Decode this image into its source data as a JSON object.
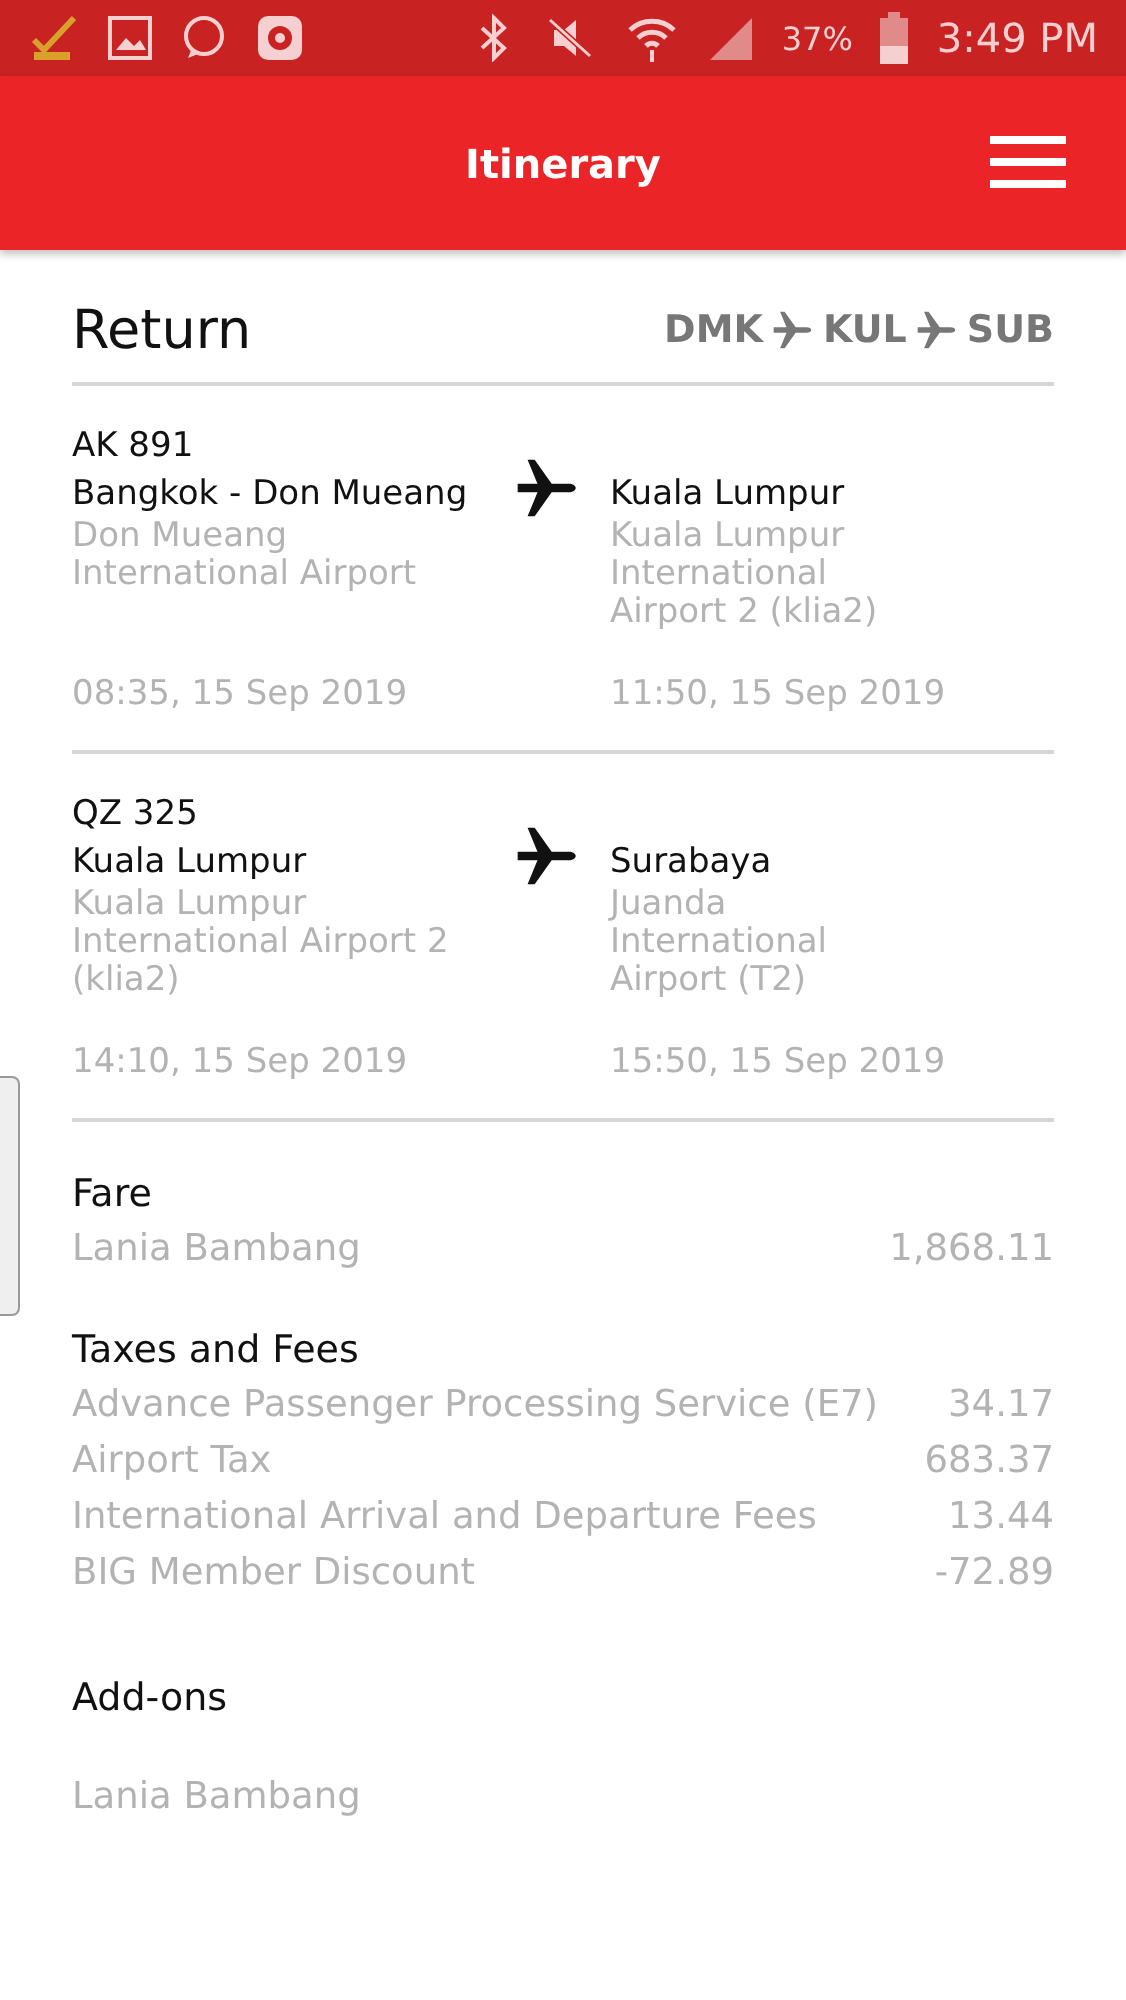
{
  "status_bar": {
    "battery": "37%",
    "time": "3:49 PM"
  },
  "header": {
    "title": "Itinerary"
  },
  "trip": {
    "title": "Return",
    "route": [
      "DMK",
      "KUL",
      "SUB"
    ]
  },
  "flights": [
    {
      "number": "AK 891",
      "from": {
        "city": "Bangkok - Don Mueang",
        "airport": "Don Mueang International Airport",
        "time": "08:35, 15 Sep 2019"
      },
      "to": {
        "city": "Kuala Lumpur",
        "airport": "Kuala Lumpur International Airport 2 (klia2)",
        "time": "11:50, 15 Sep 2019"
      }
    },
    {
      "number": "QZ 325",
      "from": {
        "city": "Kuala Lumpur",
        "airport": "Kuala Lumpur International Airport 2 (klia2)",
        "time": "14:10, 15 Sep 2019"
      },
      "to": {
        "city": "Surabaya",
        "airport": "Juanda International Airport (T2)",
        "time": "15:50, 15 Sep 2019"
      }
    }
  ],
  "sections": [
    {
      "title": "Fare",
      "items": [
        {
          "label": "Lania Bambang",
          "amount": "1,868.11"
        }
      ]
    },
    {
      "title": "Taxes and Fees",
      "items": [
        {
          "label": "Advance Passenger Processing Service (E7)",
          "amount": "34.17"
        },
        {
          "label": "Airport Tax",
          "amount": "683.37"
        },
        {
          "label": "International Arrival and Departure Fees",
          "amount": "13.44"
        },
        {
          "label": "BIG Member Discount",
          "amount": "-72.89"
        }
      ]
    },
    {
      "title": "Add-ons",
      "items": [
        {
          "label": "Lania Bambang"
        }
      ]
    }
  ]
}
